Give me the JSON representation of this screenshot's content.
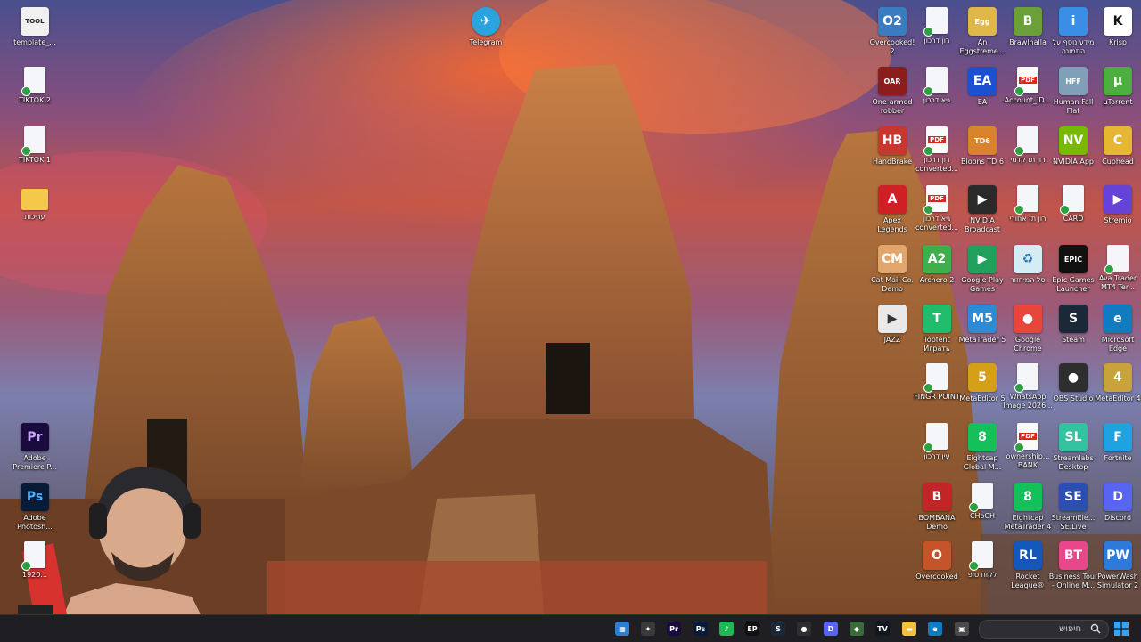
{
  "desktop": {
    "left_icons": [
      {
        "label": "template_...",
        "kind": "app",
        "color": "#f0f0f0",
        "text": "TOOL"
      },
      {
        "label": "TIKTOK 2",
        "kind": "doc"
      },
      {
        "label": "TIKTOK 1",
        "kind": "doc"
      },
      {
        "label": "עריכות",
        "kind": "folder"
      },
      {
        "label": "Adobe Premiere P...",
        "kind": "app",
        "color": "#1a0b3d",
        "text": "Pr"
      },
      {
        "label": "Adobe Photosh...",
        "kind": "app",
        "color": "#071b36",
        "text": "Ps"
      },
      {
        "label": "1920...",
        "kind": "doc"
      }
    ],
    "top_icons": [
      {
        "label": "Telegram",
        "kind": "app",
        "color": "#2aa3df",
        "text": "✈"
      }
    ],
    "right_grid": [
      [
        {
          "label": "Overcooked! 2",
          "kind": "app",
          "color": "#3b7bbf",
          "text": "O2"
        },
        {
          "label": "רון דרכון",
          "kind": "doc"
        },
        {
          "label": "An Eggstreme...",
          "kind": "app",
          "color": "#e0b84a",
          "text": "Egg"
        },
        {
          "label": "Brawlhalla",
          "kind": "app",
          "color": "#6a9f3a",
          "text": "B"
        },
        {
          "label": "מידע נוסף על התמונה",
          "kind": "app",
          "color": "#3a8ee6",
          "text": "i"
        },
        {
          "label": "Krisp",
          "kind": "app",
          "color": "#ffffff",
          "text": "K",
          "fg": "#111"
        }
      ],
      [
        {
          "label": "One-armed robber",
          "kind": "app",
          "color": "#8b1d1d",
          "text": "OAR"
        },
        {
          "label": "גיא דרכון",
          "kind": "doc"
        },
        {
          "label": "EA",
          "kind": "app",
          "color": "#1d4fd1",
          "text": "EA"
        },
        {
          "label": "Account_ID...",
          "kind": "pdf"
        },
        {
          "label": "Human Fall Flat",
          "kind": "app",
          "color": "#7fa0b8",
          "text": "HFF"
        },
        {
          "label": "µTorrent",
          "kind": "app",
          "color": "#4bae3f",
          "text": "µ"
        }
      ],
      [
        {
          "label": "HandBrake",
          "kind": "app",
          "color": "#c8372d",
          "text": "HB"
        },
        {
          "label": "רון דרכון converted...",
          "kind": "pdf"
        },
        {
          "label": "Bloons TD 6",
          "kind": "app",
          "color": "#d9832c",
          "text": "TD6"
        },
        {
          "label": "רון תז קדמי",
          "kind": "doc"
        },
        {
          "label": "NVIDIA App",
          "kind": "app",
          "color": "#76b900",
          "text": "NV"
        },
        {
          "label": "Cuphead",
          "kind": "app",
          "color": "#e7b632",
          "text": "C"
        }
      ],
      [
        {
          "label": "Apex Legends",
          "kind": "app",
          "color": "#cf2026",
          "text": "A"
        },
        {
          "label": "גיא דרכון converted...",
          "kind": "pdf"
        },
        {
          "label": "NVIDIA Broadcast",
          "kind": "app",
          "color": "#2a2a2a",
          "text": "▶"
        },
        {
          "label": "רון תז אחורי",
          "kind": "doc"
        },
        {
          "label": "CARD",
          "kind": "doc"
        },
        {
          "label": "Stremio",
          "kind": "app",
          "color": "#6643d6",
          "text": "▶"
        }
      ],
      [
        {
          "label": "Cat Mail Co. Demo",
          "kind": "app",
          "color": "#e2a66c",
          "text": "CM"
        },
        {
          "label": "Archero 2",
          "kind": "app",
          "color": "#3fae4d",
          "text": "A2"
        },
        {
          "label": "Google Play Games",
          "kind": "app",
          "color": "#21a05b",
          "text": "▶"
        },
        {
          "label": "סל המיחזור",
          "kind": "app",
          "color": "#d6ecf5",
          "text": "♻",
          "fg": "#2a7ab8"
        },
        {
          "label": "Epic Games Launcher",
          "kind": "app",
          "color": "#111111",
          "text": "EPIC"
        },
        {
          "label": "Ava Trader MT4 Ter...",
          "kind": "doc"
        }
      ],
      [
        {
          "label": "JAZZ",
          "kind": "app",
          "color": "#e9e9e9",
          "text": "▶",
          "fg": "#333"
        },
        {
          "label": "Topfent Играть",
          "kind": "app",
          "color": "#1fbd6b",
          "text": "T"
        },
        {
          "label": "MetaTrader 5",
          "kind": "app",
          "color": "#2c8bd4",
          "text": "M5"
        },
        {
          "label": "Google Chrome",
          "kind": "app",
          "color": "#e8453c",
          "text": "●"
        },
        {
          "label": "Steam",
          "kind": "app",
          "color": "#1b2838",
          "text": "S"
        },
        {
          "label": "Microsoft Edge",
          "kind": "app",
          "color": "#0f7cc2",
          "text": "e"
        }
      ],
      [
        {
          "label": "FINGR POINT",
          "kind": "doc"
        },
        {
          "label": "MetaEditor 5",
          "kind": "app",
          "color": "#d4a018",
          "text": "5"
        },
        {
          "label": "WhatsApp Image 2026...",
          "kind": "doc"
        },
        {
          "label": "OBS Studio",
          "kind": "app",
          "color": "#2e2e2e",
          "text": "●"
        },
        {
          "label": "MetaEditor 4",
          "kind": "app",
          "color": "#c8a23a",
          "text": "4"
        }
      ],
      [
        {
          "label": "עין דרכון",
          "kind": "doc"
        },
        {
          "label": "Eightcap Global M...",
          "kind": "app",
          "color": "#13c05a",
          "text": "8"
        },
        {
          "label": "ownership... BANK",
          "kind": "pdf"
        },
        {
          "label": "Streamlabs Desktop",
          "kind": "app",
          "color": "#33c3a0",
          "text": "SL"
        },
        {
          "label": "Fortnite",
          "kind": "app",
          "color": "#1fa3e0",
          "text": "F"
        }
      ],
      [
        {
          "label": "BOMBANA Demo",
          "kind": "app",
          "color": "#c12626",
          "text": "B"
        },
        {
          "label": "CHoCH",
          "kind": "doc"
        },
        {
          "label": "Eightcap MetaTrader 4",
          "kind": "app",
          "color": "#13c05a",
          "text": "8"
        },
        {
          "label": "StreamEle... SE.Live",
          "kind": "app",
          "color": "#2b4fb0",
          "text": "SE"
        },
        {
          "label": "Discord",
          "kind": "app",
          "color": "#5865f2",
          "text": "D"
        }
      ],
      [
        {
          "label": "Overcooked",
          "kind": "app",
          "color": "#c6542a",
          "text": "O"
        },
        {
          "label": "לקוח טופ",
          "kind": "doc"
        },
        {
          "label": "Rocket League®",
          "kind": "app",
          "color": "#1457b8",
          "text": "RL"
        },
        {
          "label": "Business Tour - Online M...",
          "kind": "app",
          "color": "#e9478b",
          "text": "BT"
        },
        {
          "label": "PowerWash Simulator 2",
          "kind": "app",
          "color": "#2f79d8",
          "text": "PW"
        }
      ]
    ]
  },
  "taskbar": {
    "search_placeholder": "חיפוש",
    "icons": [
      {
        "name": "calculator-icon",
        "color": "#2f7dd1",
        "text": "▦"
      },
      {
        "name": "app-icon",
        "color": "#3a3a3a",
        "text": "✦"
      },
      {
        "name": "premiere-icon",
        "color": "#1a0b3d",
        "text": "Pr"
      },
      {
        "name": "photoshop-icon",
        "color": "#071b36",
        "text": "Ps"
      },
      {
        "name": "spotify-icon",
        "color": "#1db954",
        "text": "♪"
      },
      {
        "name": "epic-icon",
        "color": "#111111",
        "text": "EP"
      },
      {
        "name": "steam-icon",
        "color": "#1b2838",
        "text": "S"
      },
      {
        "name": "obs-icon",
        "color": "#2e2e2e",
        "text": "●"
      },
      {
        "name": "discord-icon",
        "color": "#5865f2",
        "text": "D"
      },
      {
        "name": "app-icon-2",
        "color": "#3a6b3a",
        "text": "◆"
      },
      {
        "name": "tradingview-icon",
        "color": "#131722",
        "text": "TV"
      },
      {
        "name": "file-explorer-icon",
        "color": "#f3c142",
        "text": "▬"
      },
      {
        "name": "edge-icon",
        "color": "#0f7cc2",
        "text": "e"
      },
      {
        "name": "app-icon-3",
        "color": "#4a4a4a",
        "text": "▣"
      }
    ]
  }
}
